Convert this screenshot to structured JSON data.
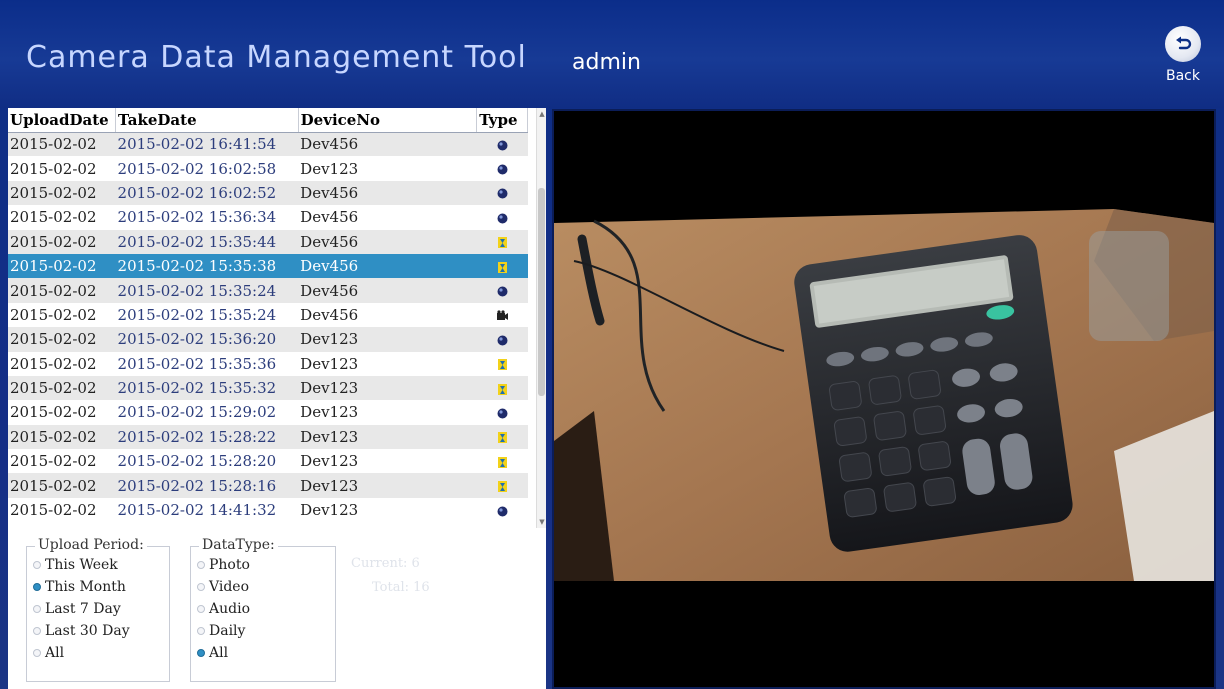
{
  "app": {
    "title": "Camera Data Management Tool",
    "user": "admin"
  },
  "back": {
    "label": "Back"
  },
  "table": {
    "columns": [
      "UploadDate",
      "TakeDate",
      "DeviceNo",
      "Type"
    ],
    "rows": [
      {
        "upload": "2015-02-02",
        "take": "2015-02-02 16:41:54",
        "device": "Dev456",
        "type": "photo"
      },
      {
        "upload": "2015-02-02",
        "take": "2015-02-02 16:02:58",
        "device": "Dev123",
        "type": "photo"
      },
      {
        "upload": "2015-02-02",
        "take": "2015-02-02 16:02:52",
        "device": "Dev456",
        "type": "photo"
      },
      {
        "upload": "2015-02-02",
        "take": "2015-02-02 15:36:34",
        "device": "Dev456",
        "type": "photo"
      },
      {
        "upload": "2015-02-02",
        "take": "2015-02-02 15:35:44",
        "device": "Dev456",
        "type": "daily"
      },
      {
        "upload": "2015-02-02",
        "take": "2015-02-02 15:35:38",
        "device": "Dev456",
        "type": "daily"
      },
      {
        "upload": "2015-02-02",
        "take": "2015-02-02 15:35:24",
        "device": "Dev456",
        "type": "photo"
      },
      {
        "upload": "2015-02-02",
        "take": "2015-02-02 15:35:24",
        "device": "Dev456",
        "type": "video"
      },
      {
        "upload": "2015-02-02",
        "take": "2015-02-02 15:36:20",
        "device": "Dev123",
        "type": "photo"
      },
      {
        "upload": "2015-02-02",
        "take": "2015-02-02 15:35:36",
        "device": "Dev123",
        "type": "daily"
      },
      {
        "upload": "2015-02-02",
        "take": "2015-02-02 15:35:32",
        "device": "Dev123",
        "type": "daily"
      },
      {
        "upload": "2015-02-02",
        "take": "2015-02-02 15:29:02",
        "device": "Dev123",
        "type": "photo"
      },
      {
        "upload": "2015-02-02",
        "take": "2015-02-02 15:28:22",
        "device": "Dev123",
        "type": "daily"
      },
      {
        "upload": "2015-02-02",
        "take": "2015-02-02 15:28:20",
        "device": "Dev123",
        "type": "daily"
      },
      {
        "upload": "2015-02-02",
        "take": "2015-02-02 15:28:16",
        "device": "Dev123",
        "type": "daily"
      },
      {
        "upload": "2015-02-02",
        "take": "2015-02-02 14:41:32",
        "device": "Dev123",
        "type": "photo"
      }
    ],
    "selected_index": 5
  },
  "filters": {
    "upload_period": {
      "title": "Upload Period:",
      "options": [
        "This Week",
        "This Month",
        "Last 7 Day",
        "Last 30 Day",
        "All"
      ],
      "selected": "This Month"
    },
    "data_type": {
      "title": "DataType:",
      "options": [
        "Photo",
        "Video",
        "Audio",
        "Daily",
        "All"
      ],
      "selected": "All"
    }
  },
  "counters": {
    "current": "Current: 6",
    "total": "Total: 16"
  },
  "icons": {
    "back": "back-arrow-icon",
    "photo": "photo-type-icon",
    "video": "video-type-icon",
    "daily": "daily-type-icon"
  },
  "colors": {
    "header": "#0d2f86",
    "selected_row": "#2f8fc4",
    "stripe": "#e8e8e8",
    "preview_bg": "#000000"
  }
}
